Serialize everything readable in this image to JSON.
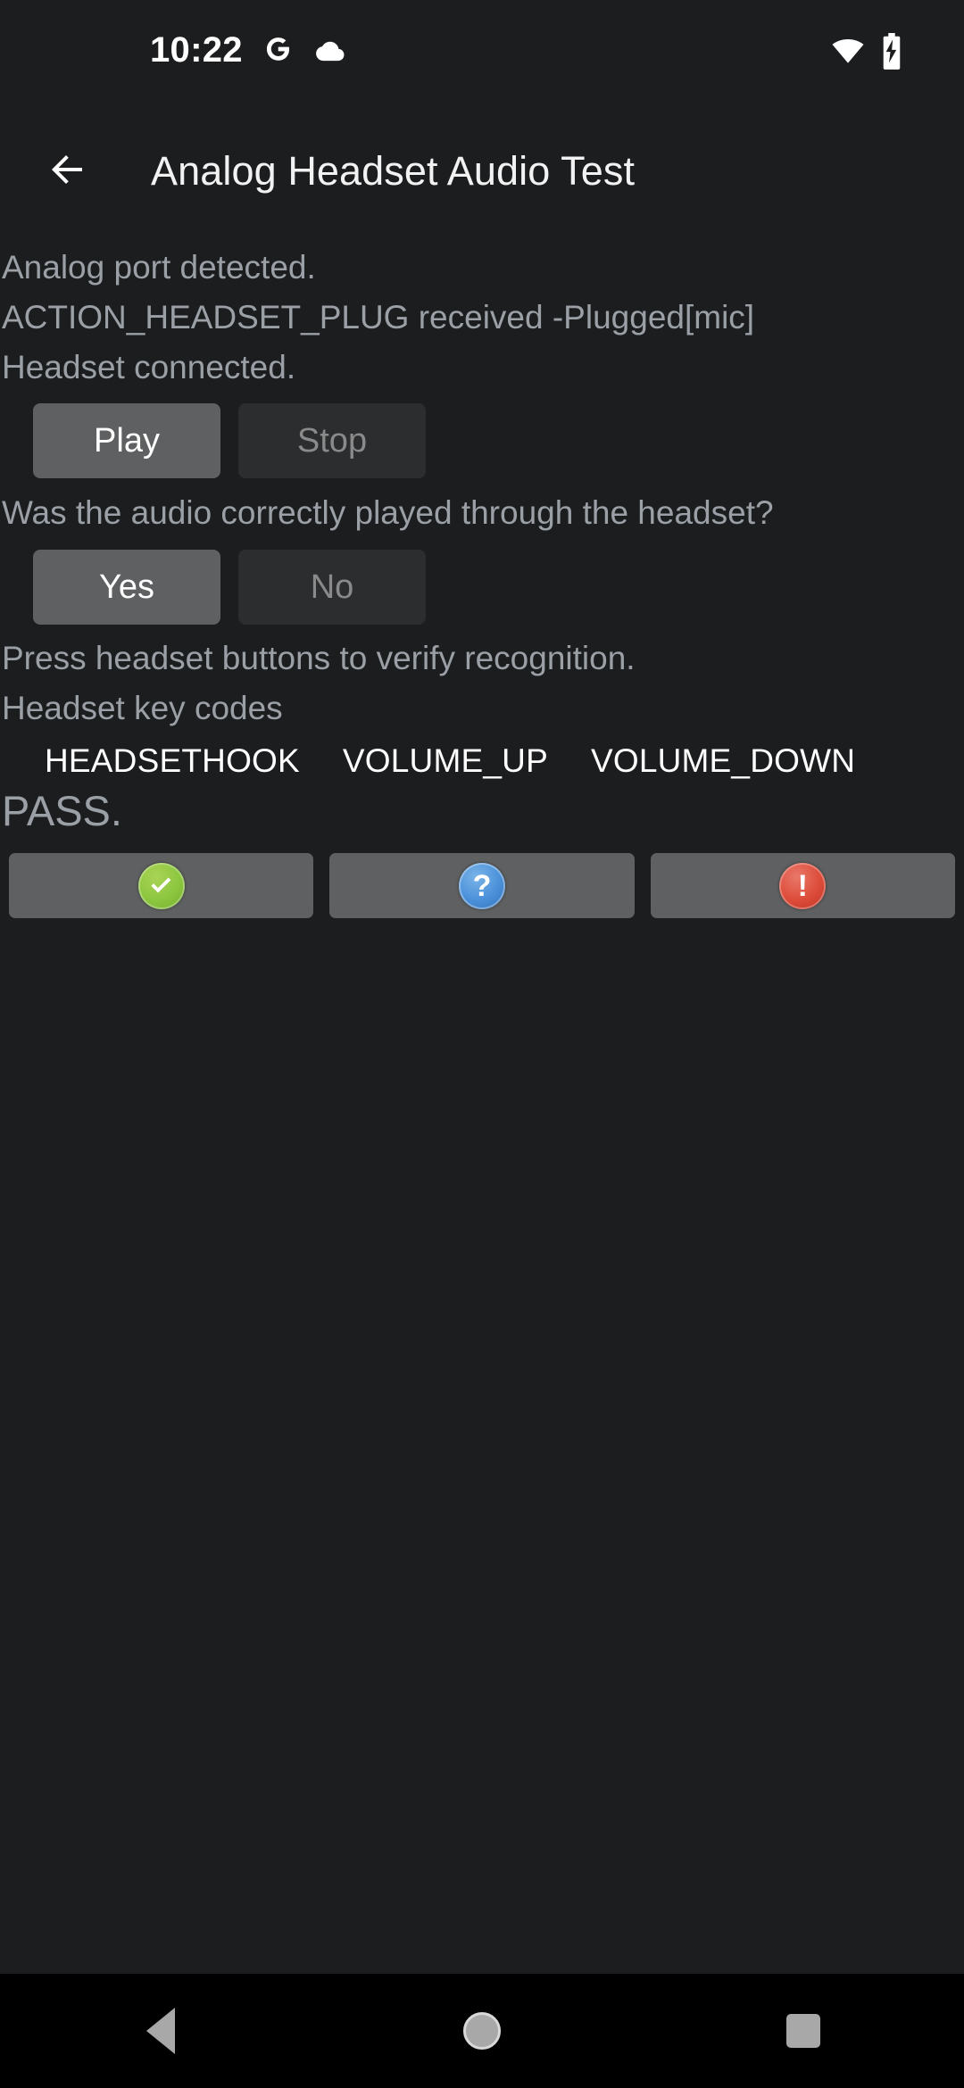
{
  "status_bar": {
    "clock": "10:22",
    "icons_left": [
      "google-g-icon",
      "cloud-icon"
    ],
    "icons_right": [
      "wifi-icon",
      "battery-charging-icon"
    ]
  },
  "action_bar": {
    "back_icon": "arrow-back-icon",
    "title": "Analog Headset Audio Test"
  },
  "main": {
    "status_lines": [
      "Analog port detected.",
      "ACTION_HEADSET_PLUG received -Plugged[mic]",
      "Headset connected."
    ],
    "playback_buttons": [
      {
        "label": "Play",
        "enabled": true
      },
      {
        "label": "Stop",
        "enabled": false
      }
    ],
    "audio_question": "Was the audio correctly played through the headset?",
    "answer_buttons": [
      {
        "label": "Yes",
        "enabled": true
      },
      {
        "label": "No",
        "enabled": false
      }
    ],
    "press_instruction": "Press headset buttons to verify recognition.",
    "keycodes_label": "Headset key codes",
    "keycodes": [
      "HEADSETHOOK",
      "VOLUME_UP",
      "VOLUME_DOWN"
    ],
    "verdict": "PASS."
  },
  "verdict_buttons": [
    {
      "name": "pass-button",
      "icon": "check-circle-icon",
      "color": "#8cc63f"
    },
    {
      "name": "info-button",
      "icon": "question-circle-icon",
      "color": "#4a90d9"
    },
    {
      "name": "fail-button",
      "icon": "exclamation-circle-icon",
      "color": "#dd4b39"
    }
  ],
  "nav_bar": {
    "back": "nav-back-icon",
    "home": "nav-home-icon",
    "recents": "nav-recents-icon"
  },
  "colors": {
    "background": "#1c1d1f",
    "button_enabled": "#5f6061",
    "button_disabled": "#2c2d2f",
    "secondary_text": "#9aa0a6",
    "primary_text": "#ffffff",
    "nav_background": "#000000"
  }
}
